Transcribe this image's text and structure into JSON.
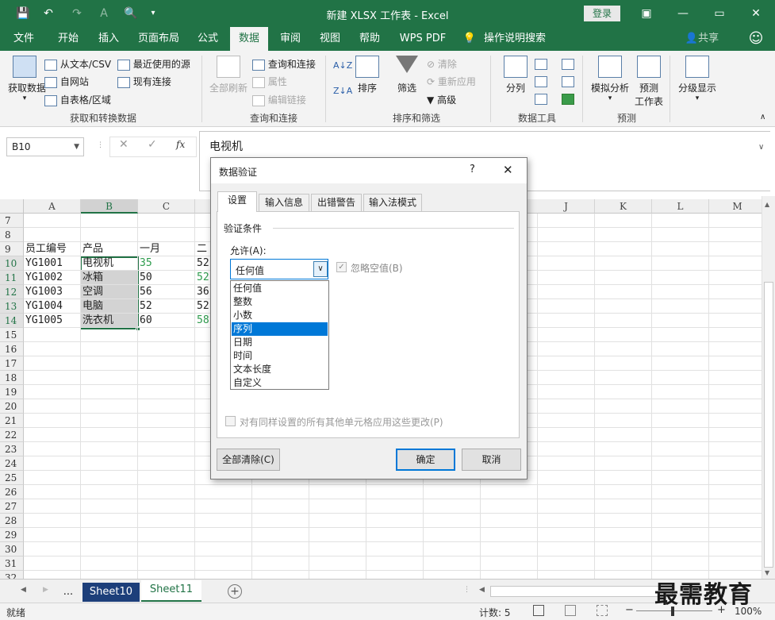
{
  "window": {
    "title": "新建 XLSX 工作表 - Excel",
    "login_label": "登录",
    "minimize": "—",
    "restore": "▭",
    "close": "✕"
  },
  "quick_access": {
    "save_icon": "save-icon",
    "undo_icon": "undo-icon",
    "redo_icon": "redo-icon",
    "print_preview_icon": "print-preview-icon"
  },
  "menu": {
    "items": [
      "文件",
      "开始",
      "插入",
      "页面布局",
      "公式",
      "数据",
      "审阅",
      "视图",
      "帮助",
      "WPS PDF",
      "操作说明搜索"
    ],
    "active_index": 5,
    "share": "共享"
  },
  "ribbon": {
    "get_data": "获取数据",
    "from_text": "从文本/CSV",
    "from_web": "自网站",
    "from_table": "自表格/区域",
    "recent_sources": "最近使用的源",
    "existing_conn": "现有连接",
    "group1": "获取和转换数据",
    "refresh_all": "全部刷新",
    "queries_conn": "查询和连接",
    "properties": "属性",
    "edit_links": "编辑链接",
    "group2": "查询和连接",
    "sort": "排序",
    "filter": "筛选",
    "clear": "清除",
    "reapply": "重新应用",
    "advanced": "高级",
    "group3": "排序和筛选",
    "split": "分列",
    "group4": "数据工具",
    "whatif": "模拟分析",
    "forecast_sheet_1": "预测",
    "forecast_sheet_2": "工作表",
    "group5": "预测",
    "outline": "分级显示"
  },
  "formula_bar": {
    "name_box": "B10",
    "cancel": "✕",
    "enter": "✓",
    "fx": "fx",
    "content": "电视机"
  },
  "grid": {
    "columns": [
      "A",
      "B",
      "C",
      "",
      "J",
      "K",
      "L",
      "M"
    ],
    "rows": [
      "7",
      "8",
      "9",
      "10",
      "11",
      "12",
      "13",
      "14",
      "15",
      "16",
      "17",
      "18",
      "19",
      "20",
      "21",
      "22",
      "23",
      "24",
      "25",
      "26",
      "27",
      "28",
      "29",
      "30",
      "31",
      "32"
    ],
    "data": [
      [
        "员工编号",
        "产品",
        "一月",
        "二"
      ],
      [
        "YG1001",
        "电视机",
        "35",
        "52"
      ],
      [
        "YG1002",
        "冰箱",
        "50",
        "52"
      ],
      [
        "YG1003",
        "空调",
        "56",
        "36"
      ],
      [
        "YG1004",
        "电脑",
        "52",
        "52"
      ],
      [
        "YG1005",
        "洗衣机",
        "60",
        "58"
      ]
    ]
  },
  "sheets": {
    "more": "...",
    "tabs": [
      "Sheet10",
      "Sheet11"
    ],
    "active_index": 1,
    "add": "+"
  },
  "status": {
    "ready": "就绪",
    "count": "计数: 5",
    "zoom": "100%"
  },
  "dialog": {
    "title": "数据验证",
    "help": "?",
    "close": "✕",
    "tabs": [
      "设置",
      "输入信息",
      "出错警告",
      "输入法模式"
    ],
    "active_tab": 0,
    "section": "验证条件",
    "allow_label": "允许(A):",
    "allow_value": "任何值",
    "ignore_blank": "忽略空值(B)",
    "options": [
      "任何值",
      "整数",
      "小数",
      "序列",
      "日期",
      "时间",
      "文本长度",
      "自定义"
    ],
    "selected_option": 3,
    "apply_all": "对有同样设置的所有其他单元格应用这些更改(P)",
    "clear_all": "全部清除(C)",
    "ok": "确定",
    "cancel": "取消"
  },
  "watermark": "最需教育"
}
